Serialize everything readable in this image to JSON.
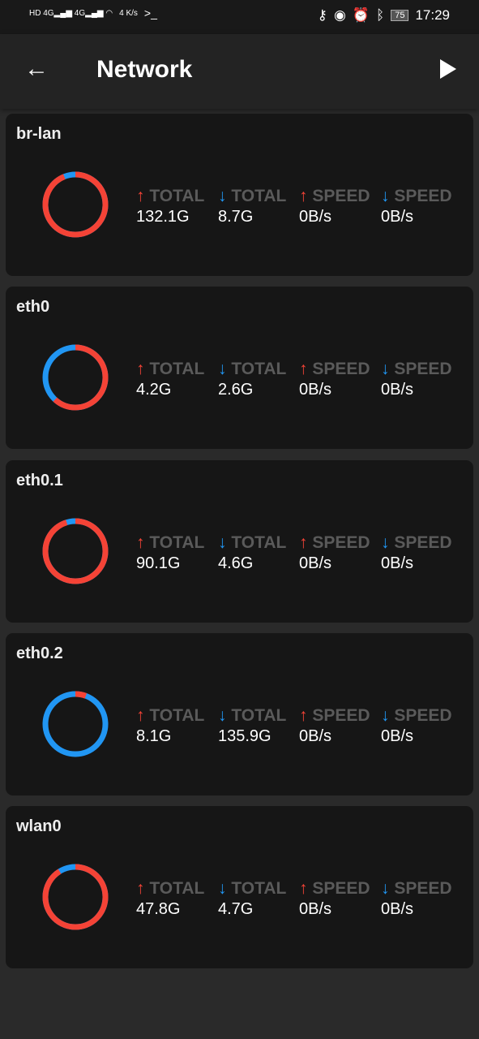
{
  "status_bar": {
    "net_speed_value": "4",
    "net_speed_unit": "K/s",
    "battery": "75",
    "time": "17:29"
  },
  "header": {
    "title": "Network"
  },
  "labels": {
    "up_total": "TOTAL",
    "down_total": "TOTAL",
    "up_speed": "SPEED",
    "down_speed": "SPEED",
    "up_arrow": "↑",
    "down_arrow": "↓"
  },
  "colors": {
    "upload": "#f44336",
    "download": "#2196f3",
    "card": "#161616"
  },
  "interfaces": [
    {
      "name": "br-lan",
      "up_total": "132.1G",
      "down_total": "8.7G",
      "up_speed": "0B/s",
      "down_speed": "0B/s",
      "up_bytes": 132.1,
      "down_bytes": 8.7
    },
    {
      "name": "eth0",
      "up_total": "4.2G",
      "down_total": "2.6G",
      "up_speed": "0B/s",
      "down_speed": "0B/s",
      "up_bytes": 4.2,
      "down_bytes": 2.6
    },
    {
      "name": "eth0.1",
      "up_total": "90.1G",
      "down_total": "4.6G",
      "up_speed": "0B/s",
      "down_speed": "0B/s",
      "up_bytes": 90.1,
      "down_bytes": 4.6
    },
    {
      "name": "eth0.2",
      "up_total": "8.1G",
      "down_total": "135.9G",
      "up_speed": "0B/s",
      "down_speed": "0B/s",
      "up_bytes": 8.1,
      "down_bytes": 135.9
    },
    {
      "name": "wlan0",
      "up_total": "47.8G",
      "down_total": "4.7G",
      "up_speed": "0B/s",
      "down_speed": "0B/s",
      "up_bytes": 47.8,
      "down_bytes": 4.7
    }
  ]
}
